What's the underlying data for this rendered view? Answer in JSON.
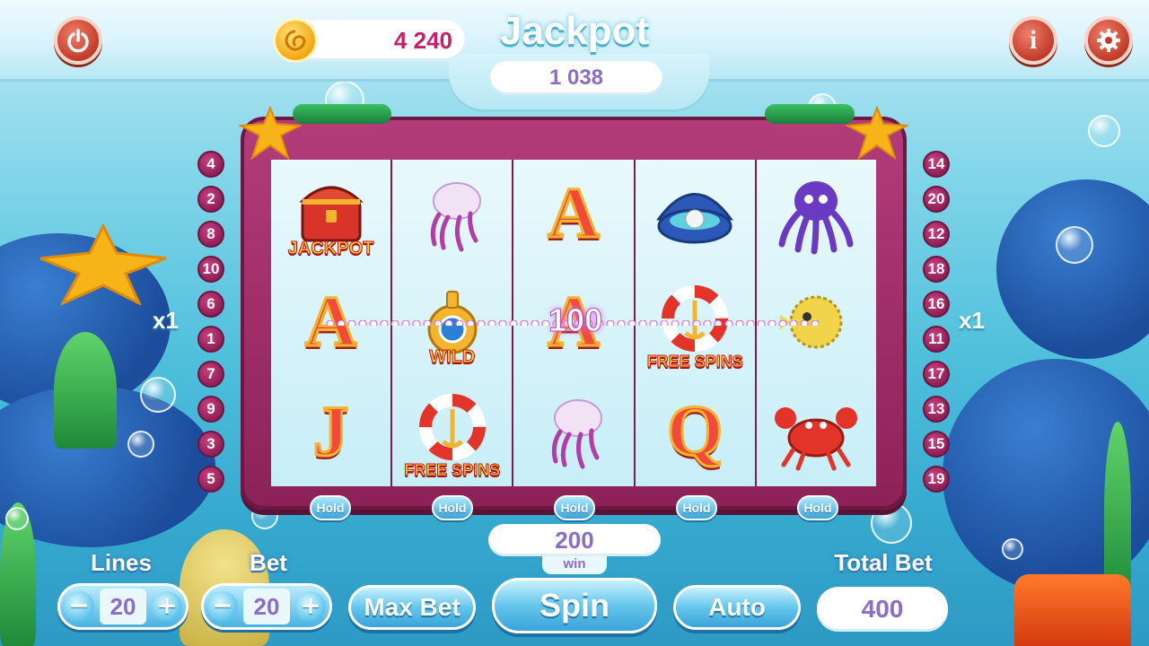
{
  "header": {
    "balance": "4 240",
    "jackpot_title": "Jackpot",
    "jackpot_value": "1 038",
    "power_icon": "power-icon",
    "coin_icon": "coin-icon",
    "info_icon": "info-icon",
    "info_glyph": "i",
    "settings_icon": "gear-icon"
  },
  "lines_left": [
    "4",
    "2",
    "8",
    "10",
    "6",
    "1",
    "7",
    "9",
    "3",
    "5"
  ],
  "lines_right": [
    "14",
    "20",
    "12",
    "18",
    "16",
    "11",
    "17",
    "13",
    "15",
    "19"
  ],
  "multiplier_left": "x1",
  "multiplier_right": "x1",
  "reels": [
    [
      {
        "symbol": "treasure-chest",
        "label": "JACKPOT"
      },
      {
        "symbol": "letter-a",
        "letter": "A"
      },
      {
        "symbol": "letter-j",
        "letter": "J"
      }
    ],
    [
      {
        "symbol": "jellyfish"
      },
      {
        "symbol": "submarine",
        "label": "WILD"
      },
      {
        "symbol": "lifebuoy",
        "label": "FREE SPINS"
      }
    ],
    [
      {
        "symbol": "letter-a",
        "letter": "A"
      },
      {
        "symbol": "letter-a",
        "letter": "A"
      },
      {
        "symbol": "jellyfish"
      }
    ],
    [
      {
        "symbol": "pearl-shell"
      },
      {
        "symbol": "lifebuoy",
        "label": "FREE SPINS"
      },
      {
        "symbol": "letter-q",
        "letter": "Q"
      }
    ],
    [
      {
        "symbol": "octopus"
      },
      {
        "symbol": "pufferfish"
      },
      {
        "symbol": "crab"
      }
    ]
  ],
  "payline_win": "100",
  "hold_label": "Hold",
  "win": {
    "amount": "200",
    "label": "win"
  },
  "controls": {
    "lines_label": "Lines",
    "lines_value": "20",
    "bet_label": "Bet",
    "bet_value": "20",
    "minus": "−",
    "plus": "+",
    "max_bet": "Max Bet",
    "spin": "Spin",
    "auto": "Auto",
    "total_bet_label": "Total Bet",
    "total_bet_value": "400"
  },
  "colors": {
    "frame": "#8c2258",
    "accent_blue": "#3aa3d8",
    "value_purple": "#8a6cc9",
    "balance_pink": "#c4206a"
  }
}
